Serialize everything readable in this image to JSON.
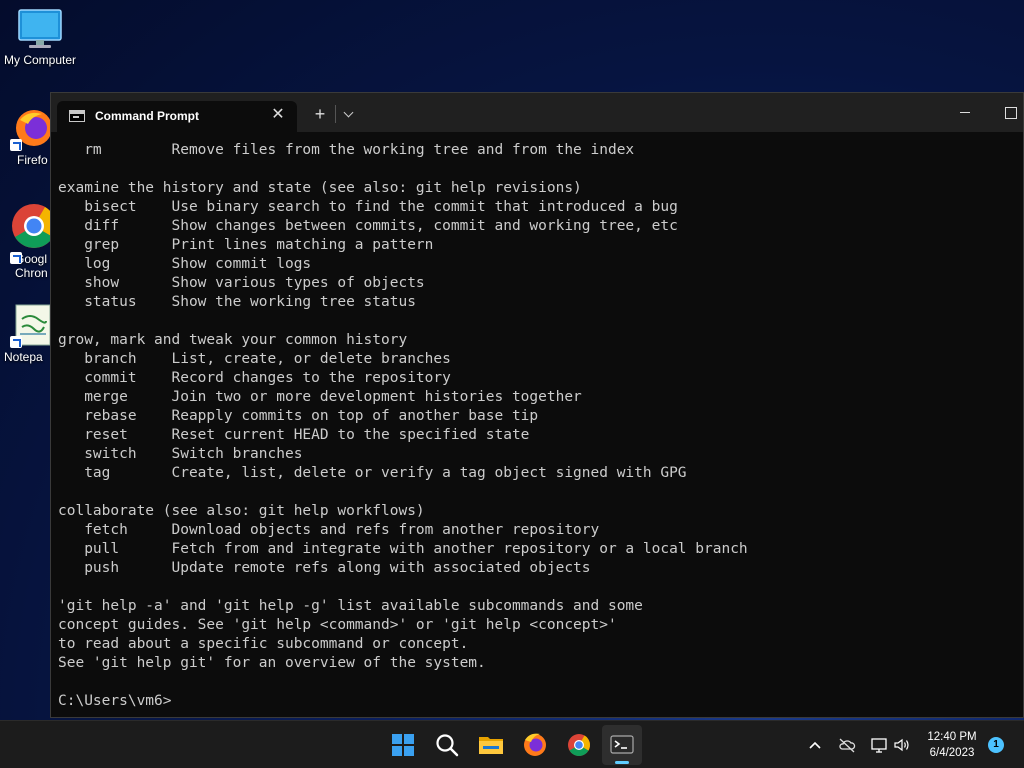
{
  "desktop": {
    "icons": [
      {
        "label": "My Computer"
      },
      {
        "label": "Firefo"
      },
      {
        "label": "Googl\nChron"
      },
      {
        "label": "Notepa"
      }
    ]
  },
  "window": {
    "tab_title": "Command Prompt",
    "close_symbol": "✕",
    "new_tab_symbol": "+"
  },
  "terminal": {
    "lines": [
      "   rm        Remove files from the working tree and from the index",
      "",
      "examine the history and state (see also: git help revisions)",
      "   bisect    Use binary search to find the commit that introduced a bug",
      "   diff      Show changes between commits, commit and working tree, etc",
      "   grep      Print lines matching a pattern",
      "   log       Show commit logs",
      "   show      Show various types of objects",
      "   status    Show the working tree status",
      "",
      "grow, mark and tweak your common history",
      "   branch    List, create, or delete branches",
      "   commit    Record changes to the repository",
      "   merge     Join two or more development histories together",
      "   rebase    Reapply commits on top of another base tip",
      "   reset     Reset current HEAD to the specified state",
      "   switch    Switch branches",
      "   tag       Create, list, delete or verify a tag object signed with GPG",
      "",
      "collaborate (see also: git help workflows)",
      "   fetch     Download objects and refs from another repository",
      "   pull      Fetch from and integrate with another repository or a local branch",
      "   push      Update remote refs along with associated objects",
      "",
      "'git help -a' and 'git help -g' list available subcommands and some",
      "concept guides. See 'git help <command>' or 'git help <concept>'",
      "to read about a specific subcommand or concept.",
      "See 'git help git' for an overview of the system.",
      "",
      "C:\\Users\\vm6>"
    ]
  },
  "taskbar": {
    "apps": [
      {
        "icon": "windows-start-icon"
      },
      {
        "icon": "search-icon"
      },
      {
        "icon": "file-explorer-icon"
      },
      {
        "icon": "firefox-icon"
      },
      {
        "icon": "chrome-icon"
      },
      {
        "icon": "terminal-icon"
      }
    ],
    "time": "12:40 PM",
    "date": "6/4/2023",
    "notification_count": "1"
  }
}
